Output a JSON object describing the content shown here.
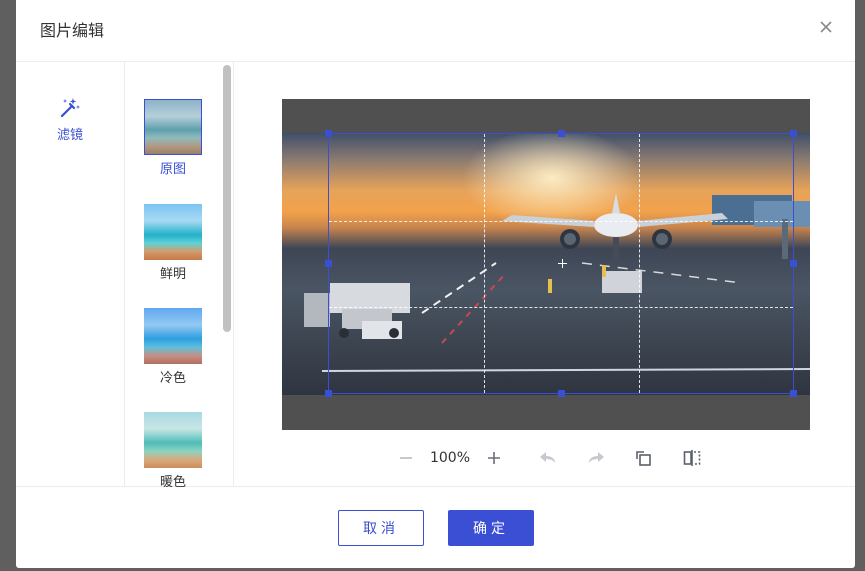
{
  "dialog": {
    "title": "图片编辑"
  },
  "tools": {
    "filter_label": "滤镜",
    "filter_icon": "magic-wand-icon"
  },
  "filters": {
    "items": [
      {
        "label": "原图",
        "active": true
      },
      {
        "label": "鲜明",
        "active": false
      },
      {
        "label": "冷色",
        "active": false
      },
      {
        "label": "暖色",
        "active": false
      }
    ]
  },
  "toolbar": {
    "zoom": "100%",
    "icons": [
      "zoom-out-icon",
      "zoom-in-icon",
      "undo-icon",
      "redo-icon",
      "rotate-icon",
      "flip-icon"
    ]
  },
  "footer": {
    "cancel_label": "取消",
    "confirm_label": "确定"
  },
  "colors": {
    "accent": "#3a4fd4",
    "overlay": "#5f5f5f"
  }
}
